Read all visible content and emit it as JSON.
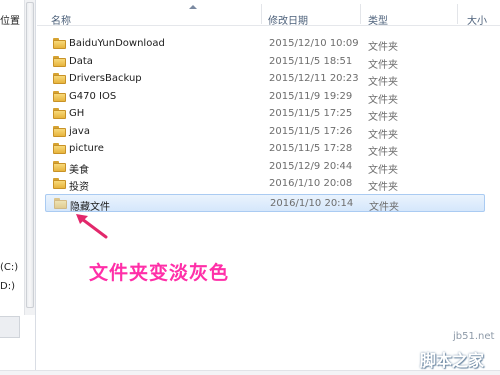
{
  "nav": {
    "fragments": [
      "位置",
      "(C:)",
      "D:)"
    ]
  },
  "columns": {
    "name": "名称",
    "date": "修改日期",
    "type": "类型",
    "size": "大小"
  },
  "files": [
    {
      "name": "BaiduYunDownload",
      "date": "2015/12/10 10:09",
      "type": "文件夹",
      "selected": false
    },
    {
      "name": "Data",
      "date": "2015/11/5 18:51",
      "type": "文件夹",
      "selected": false
    },
    {
      "name": "DriversBackup",
      "date": "2015/12/11 20:23",
      "type": "文件夹",
      "selected": false
    },
    {
      "name": "G470 IOS",
      "date": "2015/11/9 19:29",
      "type": "文件夹",
      "selected": false
    },
    {
      "name": "GH",
      "date": "2015/11/5 17:25",
      "type": "文件夹",
      "selected": false
    },
    {
      "name": "java",
      "date": "2015/11/5 17:26",
      "type": "文件夹",
      "selected": false
    },
    {
      "name": "picture",
      "date": "2015/11/5 17:28",
      "type": "文件夹",
      "selected": false
    },
    {
      "name": "美食",
      "date": "2015/12/9 20:44",
      "type": "文件夹",
      "selected": false
    },
    {
      "name": "投资",
      "date": "2016/1/10 20:08",
      "type": "文件夹",
      "selected": false
    },
    {
      "name": "隐藏文件",
      "date": "2016/1/10 20:14",
      "type": "文件夹",
      "selected": true
    }
  ],
  "annotation": {
    "text": "文件夹变淡灰色",
    "color": "#ff2fa8"
  },
  "watermark": {
    "domain": "jb51.net",
    "site": "脚本之家"
  },
  "icons": {
    "folder": "folder-icon",
    "arrow": "pointer-arrow-icon"
  }
}
